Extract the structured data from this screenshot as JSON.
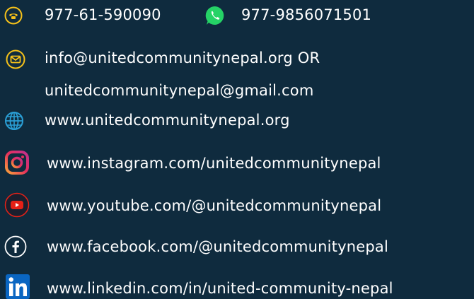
{
  "contact": {
    "phone": "977-61-590090",
    "whatsapp": "977-9856071501",
    "email_line1": "info@unitedcommunitynepal.org OR",
    "email_line2": "unitedcommunitynepal@gmail.com",
    "website": "www.unitedcommunitynepal.org",
    "instagram": "www.instagram.com/unitedcommunitynepal",
    "youtube": "www.youtube.com/@unitedcommunitynepal",
    "facebook": "www.facebook.com/@unitedcommunitynepal",
    "linkedin": "www.linkedin.com/in/united-community-nepal"
  },
  "icons": {
    "phone": "phone-icon",
    "whatsapp": "whatsapp-icon",
    "email": "email-icon",
    "website": "globe-icon",
    "instagram": "instagram-icon",
    "youtube": "youtube-icon",
    "facebook": "facebook-icon",
    "linkedin": "linkedin-icon"
  },
  "colors": {
    "background": "#0f2b3e",
    "text": "#ffffff",
    "accent_yellow": "#f6c21a",
    "whatsapp_green": "#25d366",
    "youtube_red": "#e62117",
    "instagram_gradient_start": "#f9a43a",
    "instagram_gradient_end": "#c2308e",
    "linkedin_blue": "#0a66c2",
    "globe_blue": "#2a9fd6"
  }
}
